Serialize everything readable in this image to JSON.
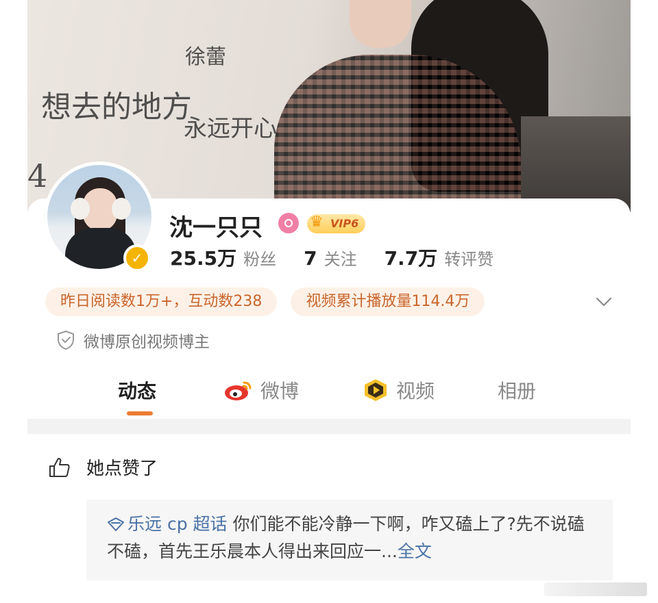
{
  "profile": {
    "name": "沈一只只",
    "vip_label": "VIP6"
  },
  "stats": [
    {
      "value": "25.5万",
      "label": "粉丝"
    },
    {
      "value": "7",
      "label": "关注"
    },
    {
      "value": "7.7万",
      "label": "转评赞"
    }
  ],
  "pills": {
    "reads": "昨日阅读数1万+，互动数238",
    "video_plays": "视频累计播放量114.4万"
  },
  "creator_label": "微博原创视频博主",
  "tabs": [
    {
      "label": "动态",
      "icon": null
    },
    {
      "label": "微博",
      "icon": "weibo-icon"
    },
    {
      "label": "视频",
      "icon": "video-icon"
    },
    {
      "label": "相册",
      "icon": null
    }
  ],
  "activity": {
    "label": "她点赞了"
  },
  "quote": {
    "topic": "乐远 cp 超话",
    "text": "  你们能不能冷静一下啊，咋又磕上了?先不说磕不磕，首先王乐晨本人得出来回应一...",
    "more": "全文"
  },
  "colors": {
    "accent": "#ec7c32",
    "link": "#4a72a6",
    "pill_bg": "#fdf1e7",
    "pill_text": "#c9652b",
    "verified": "#f5b400",
    "gender": "#f07fa6"
  }
}
